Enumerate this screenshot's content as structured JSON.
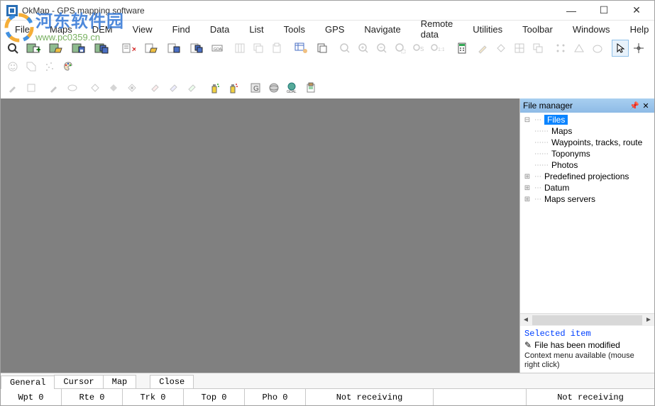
{
  "window": {
    "title": "OkMap - GPS mapping software",
    "min": "—",
    "max": "☐",
    "close": "✕"
  },
  "menu": [
    "File",
    "Maps",
    "DEM",
    "View",
    "Find",
    "Data",
    "List",
    "Tools",
    "GPS",
    "Navigate",
    "Remote data",
    "Utilities",
    "Toolbar",
    "Windows",
    "Help"
  ],
  "file_manager": {
    "title": "File manager",
    "nodes": {
      "root": "Files",
      "maps": "Maps",
      "wtr": "Waypoints, tracks, route",
      "topo": "Toponyms",
      "photos": "Photos",
      "proj": "Predefined projections",
      "datum": "Datum",
      "mapservers": "Maps servers"
    },
    "selected": {
      "header": "Selected item",
      "line": "File has been modified",
      "context": "Context menu available (mouse right click)"
    }
  },
  "tabs": [
    "General",
    "Cursor",
    "Map",
    "Close"
  ],
  "status": {
    "wpt": "Wpt 0",
    "rte": "Rte 0",
    "trk": "Trk 0",
    "top": "Top 0",
    "pho": "Pho 0",
    "recv1": "Not receiving",
    "recv2": "Not receiving"
  },
  "watermark": {
    "text": "河东软件园",
    "url": "www.pc0359.cn"
  }
}
